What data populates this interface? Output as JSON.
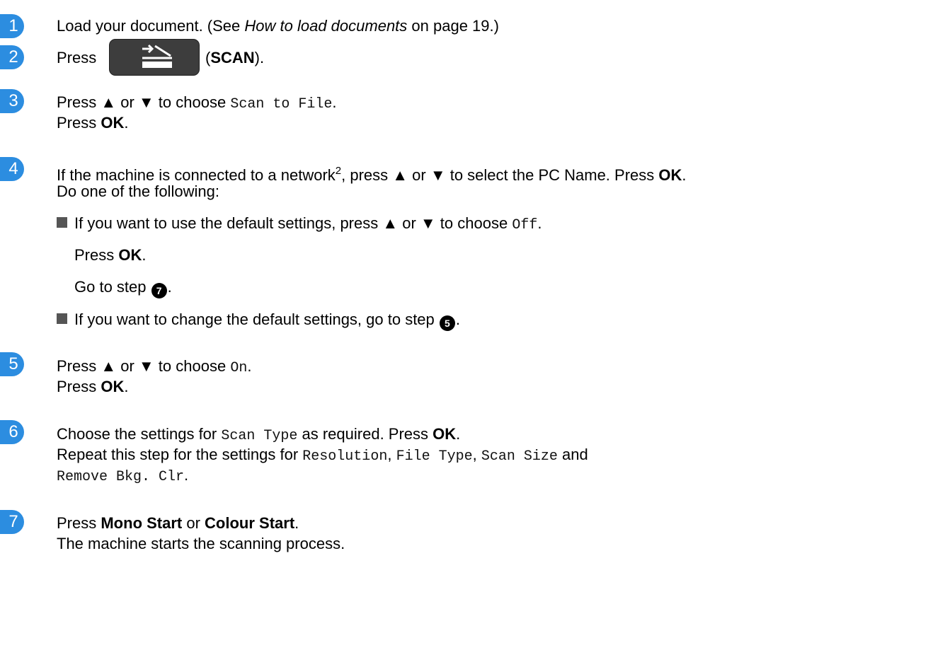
{
  "steps": [
    {
      "number": "1",
      "line1": {
        "a": "Load your document. (See ",
        "link": "How to load documents",
        "b": " on page 19.)"
      }
    },
    {
      "number": "2",
      "line1": {
        "a": "Press",
        "b": " (",
        "bold": "SCAN",
        "c": ")."
      }
    },
    {
      "number": "3",
      "line1": {
        "a": "Press ▲ or ▼ to choose ",
        "code": "Scan to File",
        "b": "."
      },
      "line2": {
        "a": "Press ",
        "bold": "OK",
        "b": "."
      }
    },
    {
      "number": "4",
      "line1": {
        "a": "If the machine is connected to a network",
        "sup": "2",
        "b": ", press ▲ or ▼ to select the PC Name. Press ",
        "bold": "OK",
        "c": "."
      },
      "line2": {
        "a": "Do one of the following:"
      },
      "bullets": [
        {
          "a": "If you want to use the default settings, press ▲ or ▼ to choose ",
          "code": "Off",
          "b": "."
        },
        {
          "a": "If you want to change the default settings, go to step ",
          "step": "5",
          "b": "."
        }
      ],
      "sub_lines": {
        "press_a": "Press ",
        "press_bold": "OK",
        "press_b": ".",
        "goto_a": "Go to step ",
        "goto_step": "7",
        "goto_b": "."
      }
    },
    {
      "number": "5",
      "line1": {
        "a": "Press ▲ or ▼ to choose ",
        "code": "On",
        "b": "."
      },
      "line2": {
        "a": "Press ",
        "bold": "OK",
        "b": "."
      }
    },
    {
      "number": "6",
      "line1": {
        "a": "Choose the settings for ",
        "code": "Scan Type",
        "b": " as required. Press ",
        "bold": "OK",
        "c": "."
      },
      "line2": {
        "a": "Repeat this step for the settings for ",
        "code1": "Resolution",
        "b": ", ",
        "code2": "File Type",
        "c": ", ",
        "code3": "Scan Size",
        "d": " and"
      },
      "line3": {
        "code": "Remove Bkg. Clr",
        "a": "."
      }
    },
    {
      "number": "7",
      "line1": {
        "a": "Press ",
        "bold1": "Mono Start",
        "b": " or ",
        "bold2": "Colour Start",
        "c": "."
      },
      "line2": {
        "a": "The machine starts the scanning process."
      }
    }
  ],
  "colors": {
    "badge": "#2c8de0",
    "button": "#3d3d3d"
  },
  "icons": {
    "scan_button": "scan-icon"
  }
}
